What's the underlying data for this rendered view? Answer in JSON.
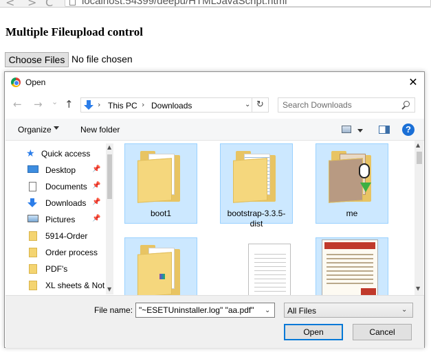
{
  "browser": {
    "url": "localhost:54399/deepu/HTMLJavaScript.html"
  },
  "page": {
    "title": "Multiple Fileupload control",
    "choose_button": "Choose Files",
    "no_file_text": "No file chosen"
  },
  "dialog": {
    "title": "Open",
    "close_glyph": "✕",
    "address": {
      "crumbs": [
        "This PC",
        "Downloads"
      ],
      "separator": "›",
      "dropdown": "⌄",
      "refresh": "↻"
    },
    "search": {
      "placeholder": "Search Downloads"
    },
    "toolbar": {
      "organize": "Organize",
      "new_folder": "New folder",
      "help": "?"
    },
    "nav": {
      "back": "←",
      "forward": "→",
      "recent": "⌄",
      "up": "↑",
      "items": [
        {
          "label": "Quick access",
          "icon": "star-icon",
          "pinned": false
        },
        {
          "label": "Desktop",
          "icon": "desktop-icon",
          "pinned": true
        },
        {
          "label": "Documents",
          "icon": "documents-icon",
          "pinned": true
        },
        {
          "label": "Downloads",
          "icon": "downloads-icon",
          "pinned": true
        },
        {
          "label": "Pictures",
          "icon": "pictures-icon",
          "pinned": true
        },
        {
          "label": "5914-Order",
          "icon": "folder-icon",
          "pinned": false
        },
        {
          "label": "Order process",
          "icon": "folder-icon",
          "pinned": false
        },
        {
          "label": "PDF's",
          "icon": "folder-icon",
          "pinned": false
        },
        {
          "label": "XL sheets & Not",
          "icon": "folder-icon",
          "pinned": false
        }
      ]
    },
    "files": [
      {
        "name": "boot1",
        "type": "folder"
      },
      {
        "name": "bootstrap-3.3.5-dist",
        "type": "folder"
      },
      {
        "name": "me",
        "type": "folder"
      },
      {
        "name": "",
        "type": "folder"
      },
      {
        "name": "",
        "type": "text-document"
      },
      {
        "name": "",
        "type": "pdf-document"
      }
    ],
    "footer": {
      "filename_label": "File name:",
      "filename_value": "\"~ESETUninstaller.log\" \"aa.pdf\"",
      "filetype_value": "All Files",
      "open_button": "Open",
      "cancel_button": "Cancel"
    }
  },
  "colors": {
    "selection_fill": "#cce8ff",
    "selection_border": "#99d1ff",
    "accent": "#0078d7"
  }
}
